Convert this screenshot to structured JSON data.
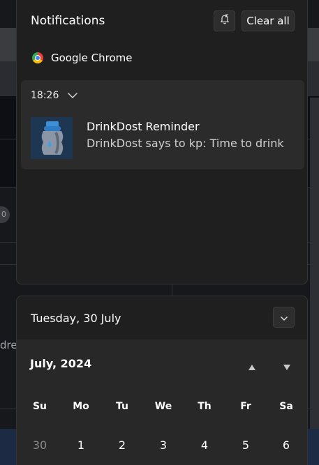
{
  "background": {
    "partial_text": "dres",
    "pill_text": "0"
  },
  "notifications": {
    "title": "Notifications",
    "clear_all_label": "Clear all",
    "app_name": "Google Chrome",
    "card": {
      "time": "18:26",
      "title": "DrinkDost Reminder",
      "body": "DrinkDost says to kp: Time to drink"
    }
  },
  "calendar": {
    "date_header": "Tuesday, 30 July",
    "month_label": "July, 2024",
    "weekdays": [
      "Su",
      "Mo",
      "Tu",
      "We",
      "Th",
      "Fr",
      "Sa"
    ],
    "first_row": [
      "30",
      "1",
      "2",
      "3",
      "4",
      "5",
      "6"
    ]
  },
  "colors": {
    "panel_bg": "#1f1f1f",
    "card_bg": "#2b2b2b",
    "accent_blue": "#4aa3e8"
  }
}
